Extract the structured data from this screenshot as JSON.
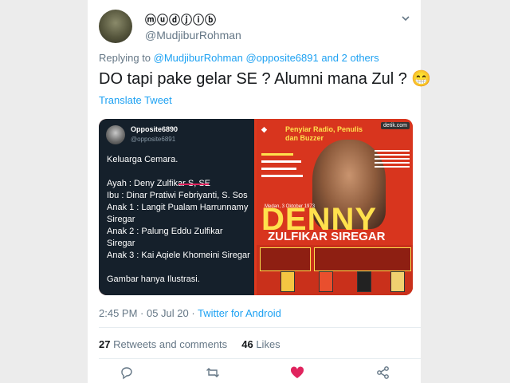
{
  "tweet": {
    "display_name": "ⓜⓤⓓⓙⓘⓑ",
    "handle": "@MudjiburRohman",
    "replying_prefix": "Replying to ",
    "replying_users": "@MudjiburRohman @opposite6891 and 2 others",
    "text": "DO tapi pake gelar SE ? Alumni mana Zul ? 😁",
    "translate_label": "Translate Tweet",
    "time": "2:45 PM · 05 Jul 20 · ",
    "app": "Twitter for Android",
    "retweets_count": "27",
    "retweets_label": "Retweets and comments",
    "likes_count": "46",
    "likes_label": "Likes"
  },
  "embedded_tweet": {
    "name": "Opposite6890",
    "handle": "@opposite6891",
    "body": "Keluarga Cemara.\n\nAyah : Deny Zulfikar S, SE\nIbu : Dinar Pratiwi Febriyanti, S. Sos\nAnak 1 : Langit Pualam Harrunnamy Siregar\nAnak 2 : Palung Eddu Zulfikar Siregar\nAnak 3 : Kai Aqiele Khomeini Siregar\n\nGambar hanya Ilustrasi."
  },
  "poster": {
    "header": "Penyiar Radio, Penulis\ndan Buzzer",
    "site": "detik.com",
    "date": "Medan, 3 Oktober 1973",
    "title": "DENNY",
    "subtitle": "ZULFIKAR SIREGAR"
  },
  "colors": {
    "accent": "#1da1f2",
    "like": "#e0245e",
    "poster_red": "#d8351e",
    "poster_yellow": "#ffe14d"
  },
  "icons": [
    "chevron-down-icon",
    "reply-icon",
    "retweet-icon",
    "like-icon",
    "share-icon"
  ]
}
